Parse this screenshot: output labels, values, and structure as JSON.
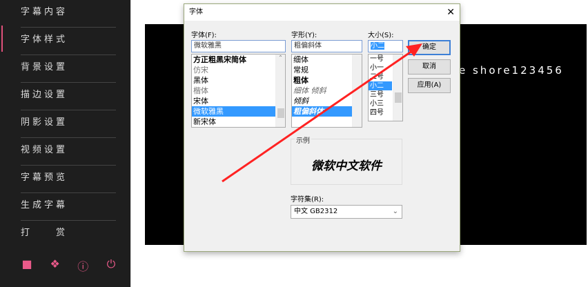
{
  "sidebar": {
    "items": [
      "字幕内容",
      "字体样式",
      "背景设置",
      "描边设置",
      "阴影设置",
      "视频设置",
      "字幕预览",
      "生成字幕",
      "打　　赏"
    ],
    "icons": [
      "save-icon",
      "cube-icon",
      "help-icon",
      "power-icon"
    ],
    "accent": "#e0507a"
  },
  "preview": {
    "text": "e shore123456"
  },
  "dialog": {
    "title": "字体",
    "close": "✕",
    "font_label": "字体(F):",
    "font_value": "微软雅黑",
    "fonts": [
      "方正粗黑宋简体",
      "仿宋",
      "黑体",
      "楷体",
      "宋体",
      "微软雅黑",
      "新宋体"
    ],
    "style_label": "字形(Y):",
    "style_value": "粗偏斜体",
    "styles": [
      "细体",
      "常规",
      "粗体",
      "细体 倾斜",
      "倾斜",
      "粗偏斜体"
    ],
    "size_label": "大小(S):",
    "size_value": "小二",
    "sizes": [
      "一号",
      "小一",
      "二号",
      "小二",
      "三号",
      "小三",
      "四号"
    ],
    "ok": "确定",
    "cancel": "取消",
    "apply": "应用(A)",
    "sample_label": "示例",
    "sample_text": "微软中文软件",
    "charset_label": "字符集(R):",
    "charset_value": "中文 GB2312"
  }
}
